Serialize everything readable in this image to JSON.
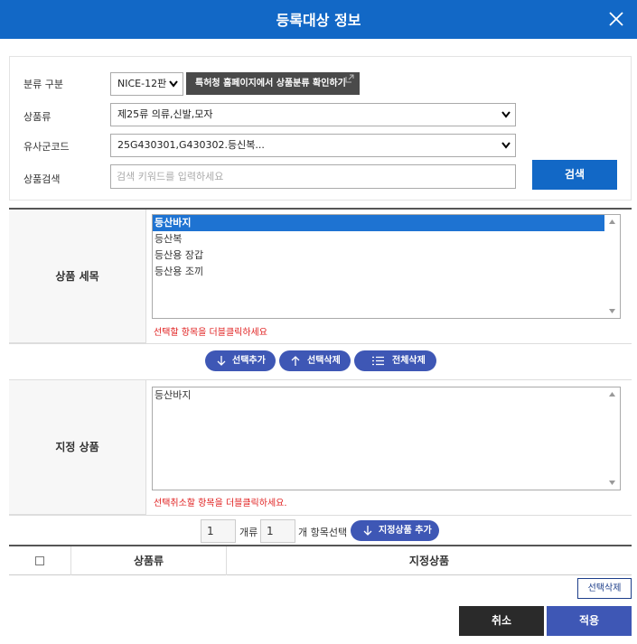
{
  "dialog": {
    "title": "등록대상 정보"
  },
  "search": {
    "class_label": "분류 구분",
    "class_value": "NICE-12판",
    "kipo_button": "특허청 홈페이지에서 상품분류 확인하기",
    "category_label": "상품류",
    "category_value": "제25류 의류,신발,모자",
    "similar_label": "유사군코드",
    "similar_value": "25G430301,G430302.등신복...",
    "keyword_label": "상품검색",
    "keyword_placeholder": "검색 키워드를 입력하세요",
    "search_button": "검색"
  },
  "goods_detail": {
    "label": "상품 세목",
    "items": [
      "등산바지",
      "등산복",
      "등산용 장갑",
      "등산용 조끼"
    ],
    "selected_index": 0,
    "hint": "선택할 항목을 더블클릭하세요"
  },
  "actions": {
    "add": "선택추가",
    "remove": "선택삭제",
    "remove_all": "전체삭제"
  },
  "designated": {
    "label": "지정 상품",
    "items": [
      "등산바지"
    ],
    "hint": "선택취소할 항목을 더블클릭하세요."
  },
  "counter": {
    "class_count": "1",
    "class_unit": "개류",
    "item_count": "1",
    "item_unit": "개 항목선택",
    "add_button": "지정상품 추가"
  },
  "result_table": {
    "columns": [
      "상품류",
      "지정상품"
    ]
  },
  "footer": {
    "delete_selected": "선택삭제",
    "cancel": "취소",
    "apply": "적용"
  },
  "colors": {
    "header_blue": "#1268c6",
    "pill_blue": "#3e57b5",
    "hint_red": "#e02020"
  },
  "icons": [
    "close-icon",
    "external-link-icon",
    "chevron-down-icon",
    "arrow-down-icon",
    "arrow-up-icon",
    "list-icon"
  ]
}
